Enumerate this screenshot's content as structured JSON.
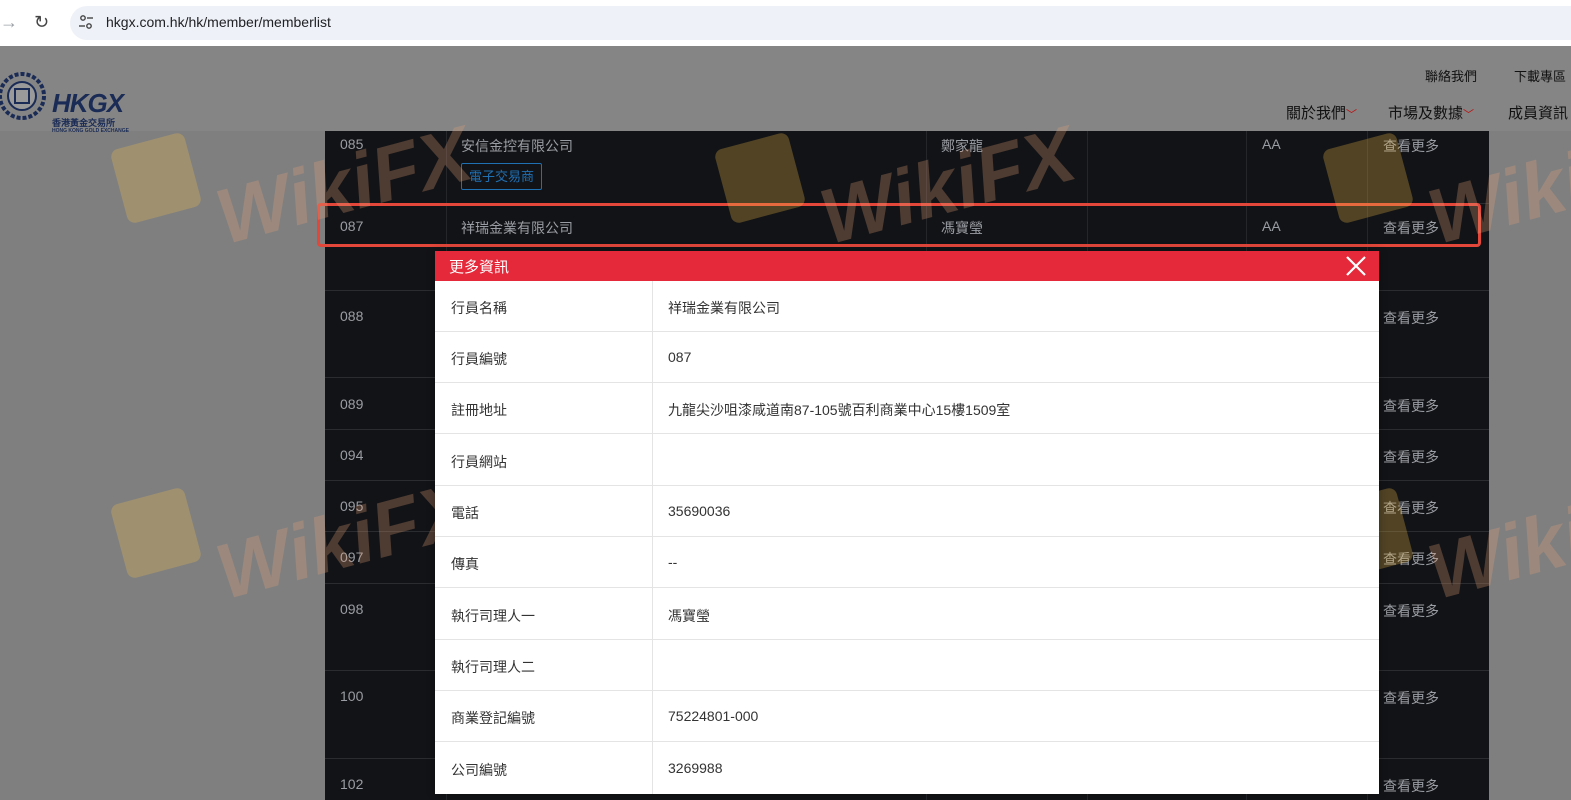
{
  "browser": {
    "url": "hkgx.com.hk/hk/member/memberlist"
  },
  "header": {
    "logo_text": "HKGX",
    "logo_sub_cn": "香港黃金交易所",
    "logo_sub_en": "HONG KONG GOLD EXCHANGE",
    "top_links": [
      "聯絡我們",
      "下載專區"
    ],
    "nav": [
      "關於我們",
      "市場及數據",
      "成員資訊"
    ]
  },
  "table": {
    "more_label": "查看更多",
    "ecom_tag": "電子交易商",
    "rows": [
      {
        "id": "085",
        "company": "安信金控有限公司",
        "rep": "鄭家龍",
        "grade": "AA"
      },
      {
        "id": "087",
        "company": "祥瑞金業有限公司",
        "rep": "馮寶瑩",
        "grade": "AA"
      },
      {
        "id": "088"
      },
      {
        "id": "089"
      },
      {
        "id": "094"
      },
      {
        "id": "095"
      },
      {
        "id": "097"
      },
      {
        "id": "098"
      },
      {
        "id": "100"
      },
      {
        "id": "102"
      }
    ]
  },
  "watermark": {
    "text": "WikiFX"
  },
  "modal": {
    "title": "更多資訊",
    "rows": [
      {
        "label": "行員名稱",
        "value": "祥瑞金業有限公司"
      },
      {
        "label": "行員編號",
        "value": "087"
      },
      {
        "label": "註冊地址",
        "value": "九龍尖沙咀漆咸道南87-105號百利商業中心15樓1509室"
      },
      {
        "label": "行員網站",
        "value": ""
      },
      {
        "label": "電話",
        "value": "35690036"
      },
      {
        "label": "傳真",
        "value": "--"
      },
      {
        "label": "執行司理人一",
        "value": "馮寶瑩"
      },
      {
        "label": "執行司理人二",
        "value": ""
      },
      {
        "label": "商業登記編號",
        "value": "75224801-000"
      },
      {
        "label": "公司編號",
        "value": "3269988"
      }
    ]
  }
}
